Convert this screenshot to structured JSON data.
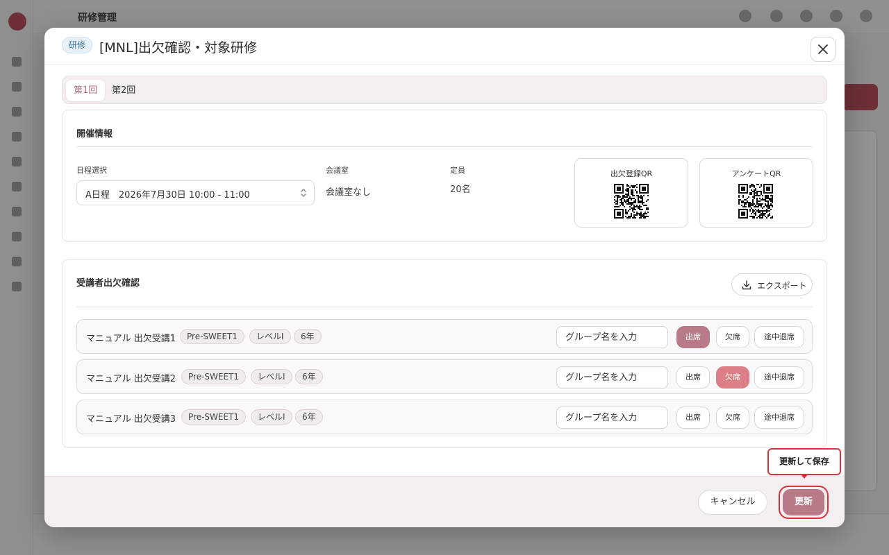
{
  "background": {
    "title": "研修管理"
  },
  "modal": {
    "badge": "研修",
    "title": "[MNL]出欠確認・対象研修",
    "close_icon": "close-icon"
  },
  "tabs": [
    {
      "label": "第1回",
      "active": true
    },
    {
      "label": "第2回",
      "active": false
    }
  ],
  "event_info": {
    "section_title": "開催情報",
    "schedule_label": "日程選択",
    "schedule_value": "A日程　2026年7月30日 10:00 - 11:00",
    "room_label": "会議室",
    "room_value": "会議室なし",
    "capacity_label": "定員",
    "capacity_value": "20名",
    "qr_attendance_label": "出欠登録QR",
    "qr_survey_label": "アンケートQR"
  },
  "attendance": {
    "section_title": "受講者出欠確認",
    "export_label": "エクスポート",
    "group_placeholder": "グループ名を入力",
    "btn_present": "出席",
    "btn_absent": "欠席",
    "btn_left_early": "途中退席",
    "rows": [
      {
        "name": "マニュアル 出欠受講1",
        "tags": [
          "Pre-SWEET1",
          "レベルI",
          "6年"
        ],
        "status": "present"
      },
      {
        "name": "マニュアル 出欠受講2",
        "tags": [
          "Pre-SWEET1",
          "レベルI",
          "6年"
        ],
        "status": "absent"
      },
      {
        "name": "マニュアル 出欠受講3",
        "tags": [
          "Pre-SWEET1",
          "レベルI",
          "6年"
        ],
        "status": "none"
      }
    ]
  },
  "footer": {
    "cancel_label": "キャンセル",
    "update_label": "更新",
    "tooltip": "更新して保存"
  },
  "colors": {
    "accent": "#b77a86",
    "absent": "#dc7f86",
    "highlight": "#d9323d",
    "badge_bg": "#e6f1f8"
  }
}
